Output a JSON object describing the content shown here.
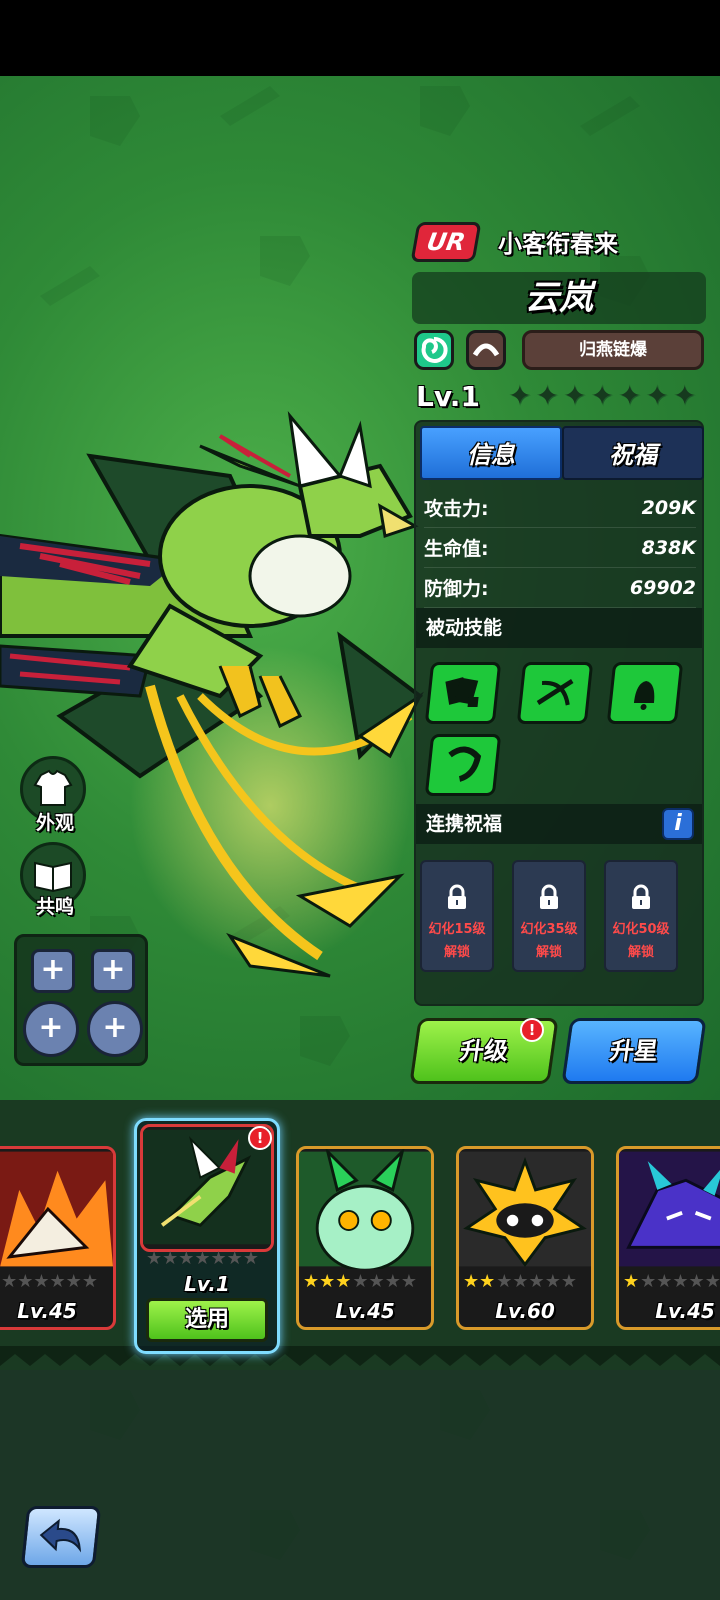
{
  "hero": {
    "rarity": "UR",
    "skin_title": "小客衔春来",
    "name": "云岚",
    "skill_name": "归燕链爆",
    "level": "Lv.1",
    "star_count": 0,
    "max_stars": 7
  },
  "panel": {
    "tabs": [
      {
        "label": "信息",
        "active": true
      },
      {
        "label": "祝福",
        "active": false
      }
    ],
    "stats": [
      {
        "label": "攻击力:",
        "value": "209K"
      },
      {
        "label": "生命值:",
        "value": "838K"
      },
      {
        "label": "防御力:",
        "value": "69902"
      }
    ],
    "passive_title": "被动技能",
    "passive_icons": [
      "dice-cards-icon",
      "crossbow-icon",
      "bell-icon",
      "horn-icon"
    ],
    "link_title": "连携祝福",
    "info_label": "i",
    "locks": [
      {
        "req": "幻化15级",
        "status": "解锁"
      },
      {
        "req": "幻化35级",
        "status": "解锁"
      },
      {
        "req": "幻化50级",
        "status": "解锁"
      }
    ]
  },
  "actions": {
    "upgrade_label": "升级",
    "upgrade_alert": "!",
    "star_label": "升星"
  },
  "side": {
    "appearance_label": "外观",
    "resonance_label": "共鸣"
  },
  "roster": {
    "cards": [
      {
        "name": "fire-beast",
        "level": "Lv.45",
        "stars": 0,
        "border": "#d93a3a"
      },
      {
        "name": "green-bird",
        "level": "Lv.1",
        "stars": 0,
        "border": "#d93a3a",
        "selected": true,
        "alert": "!"
      },
      {
        "name": "mint-owl",
        "level": "Lv.45",
        "stars": 3,
        "border": "#d99a2a"
      },
      {
        "name": "yellow-puffer",
        "level": "Lv.60",
        "stars": 2,
        "border": "#d99a2a"
      },
      {
        "name": "purple-dragon",
        "level": "Lv.45",
        "stars": 1,
        "border": "#d99a2a"
      }
    ],
    "use_label": "选用"
  },
  "colors": {
    "bg_green": "#2f8a37",
    "rarity_red": "#e0263a",
    "tab_blue": "#2f85ee",
    "upgrade_green": "#6fd82a",
    "star_blue": "#3a95f5",
    "star_gold": "#ffd21e"
  }
}
